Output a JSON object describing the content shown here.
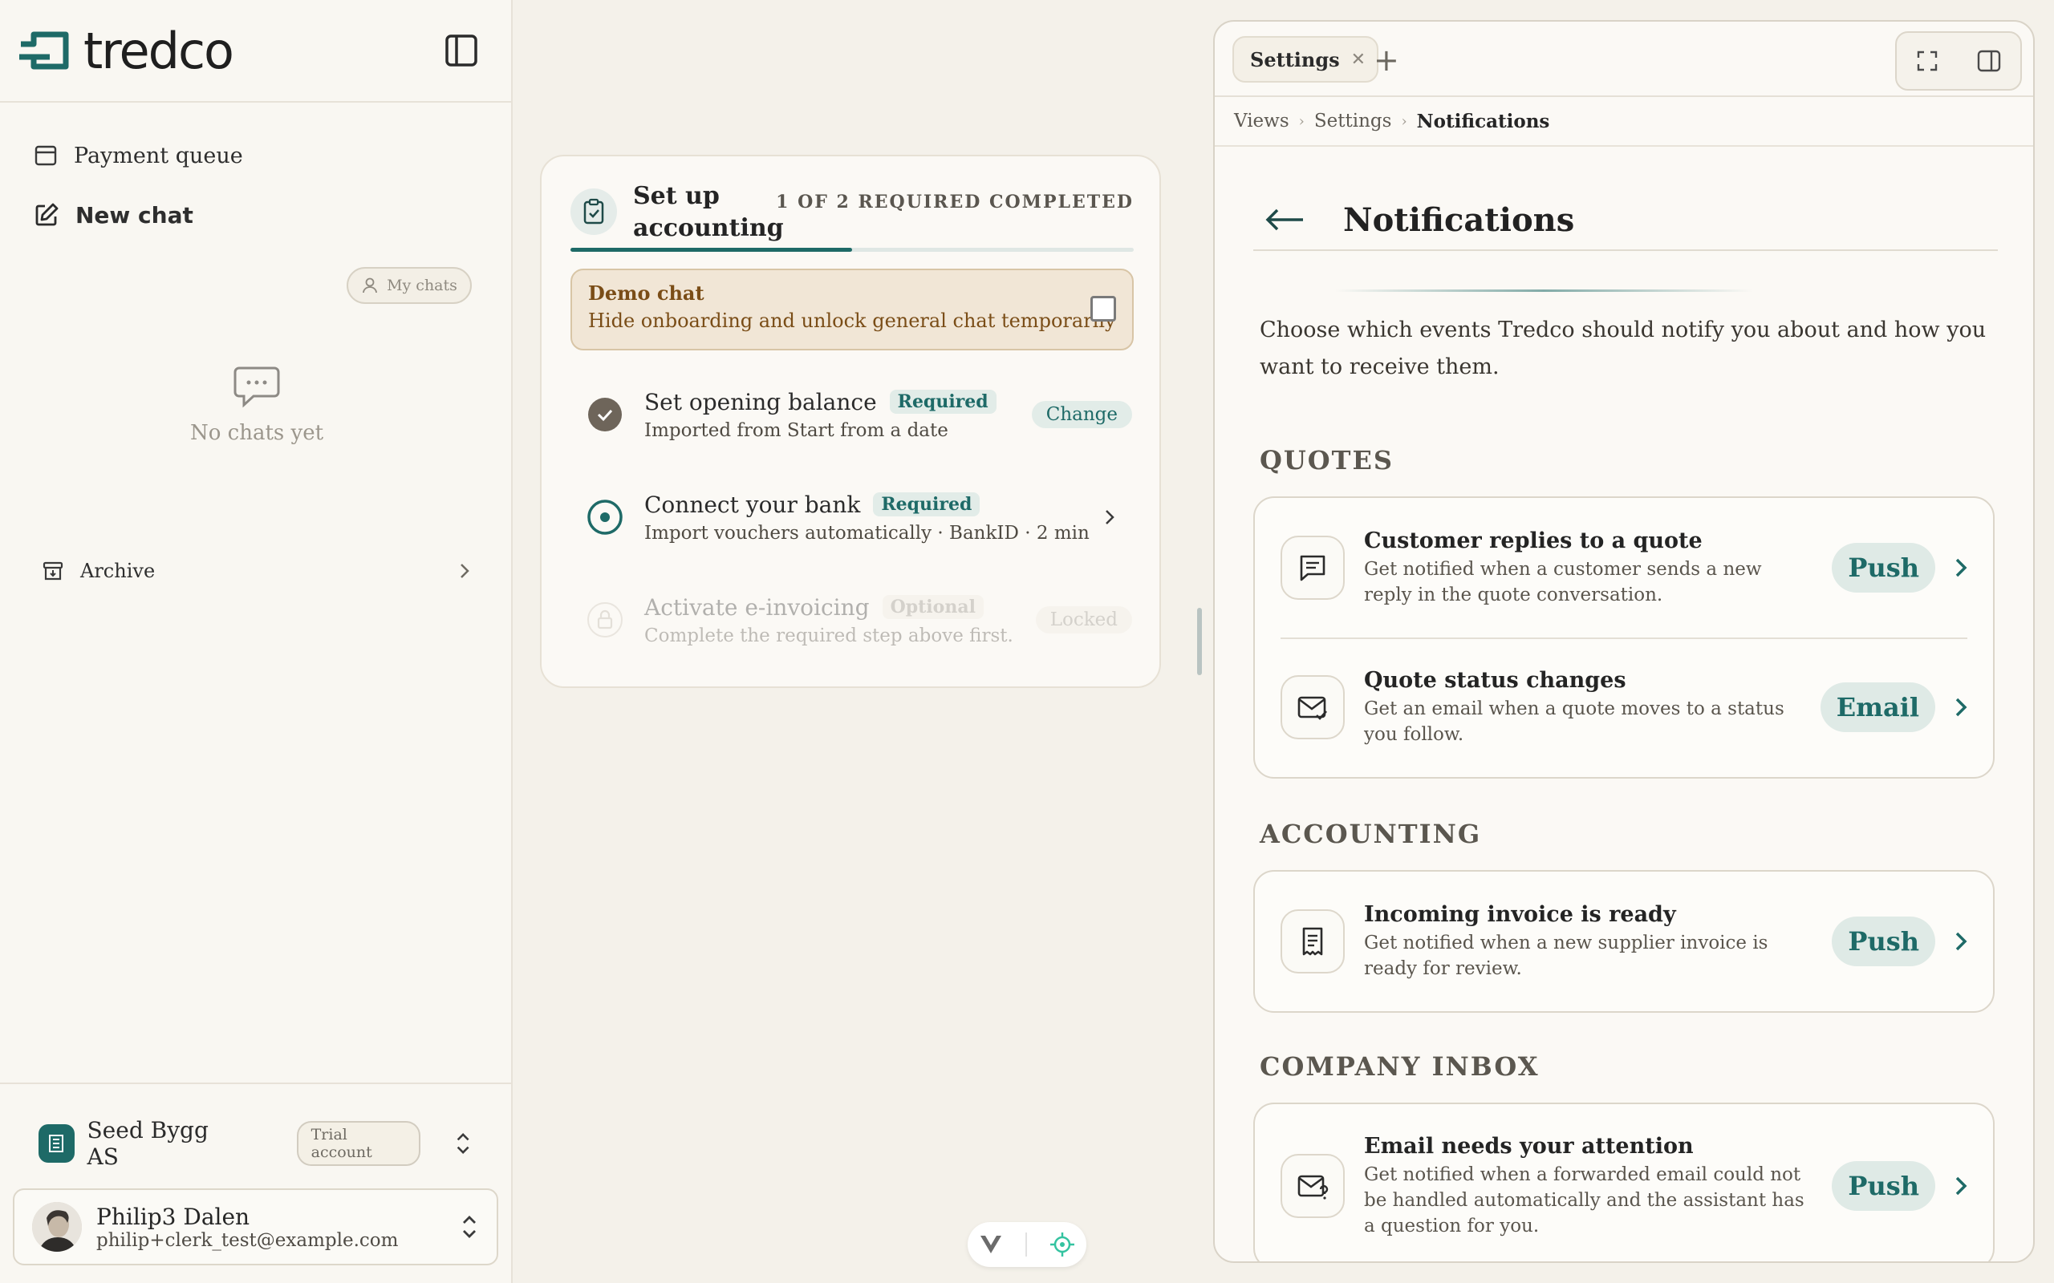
{
  "app": {
    "brand": "tredco",
    "accent": "#1e6a67"
  },
  "sidebar": {
    "nav": [
      {
        "label": "Payment queue",
        "icon": "inbox-icon"
      },
      {
        "label": "New chat",
        "icon": "edit-icon"
      }
    ],
    "my_chats_label": "My chats",
    "empty_label": "No chats yet",
    "archive_label": "Archive",
    "company": {
      "name": "Seed Bygg AS",
      "badge": "Trial account"
    },
    "user": {
      "name": "Philip3 Dalen",
      "email": "philip+clerk_test@example.com"
    }
  },
  "onboarding": {
    "title": "Set up accounting",
    "count": "1 OF 2 REQUIRED COMPLETED",
    "progress": 0.5,
    "demo": {
      "title": "Demo chat",
      "desc": "Hide onboarding and unlock general chat temporarily",
      "checked": false
    },
    "steps": [
      {
        "name": "Set opening balance",
        "badge": "Required",
        "desc": "Imported from Start from a date",
        "action": "Change",
        "state": "done"
      },
      {
        "name": "Connect your bank",
        "badge": "Required",
        "desc": "Import vouchers automatically · BankID · 2 min",
        "action": "",
        "state": "current"
      },
      {
        "name": "Activate e-invoicing",
        "badge": "Optional",
        "desc": "Complete the required step above first.",
        "action": "Locked",
        "state": "locked"
      }
    ]
  },
  "panel": {
    "tab_label": "Settings",
    "breadcrumbs": [
      "Views",
      "Settings",
      "Notifications"
    ],
    "title": "Notifications",
    "intro": "Choose which events Tredco should notify you about and how you want to receive them.",
    "sections": [
      {
        "title": "QUOTES",
        "items": [
          {
            "title": "Customer replies to a quote",
            "desc": "Get notified when a customer sends a new reply in the quote conversation.",
            "channel": "Push",
            "icon": "message-icon"
          },
          {
            "title": "Quote status changes",
            "desc": "Get an email when a quote moves to a status you follow.",
            "channel": "Email",
            "icon": "mail-check-icon"
          }
        ]
      },
      {
        "title": "ACCOUNTING",
        "items": [
          {
            "title": "Incoming invoice is ready",
            "desc": "Get notified when a new supplier invoice is ready for review.",
            "channel": "Push",
            "icon": "receipt-icon"
          }
        ]
      },
      {
        "title": "COMPANY INBOX",
        "items": [
          {
            "title": "Email needs your attention",
            "desc": "Get notified when a forwarded email could not be handled automatically and the assistant has a question for you.",
            "channel": "Push",
            "icon": "mail-question-icon"
          }
        ]
      }
    ]
  }
}
